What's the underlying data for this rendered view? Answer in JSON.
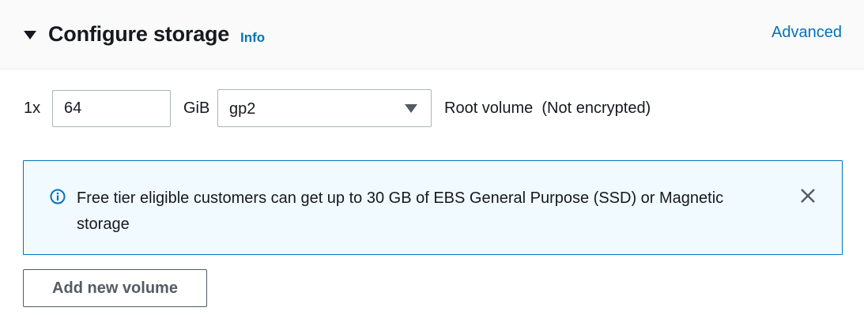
{
  "section": {
    "title": "Configure storage",
    "info_link": "Info",
    "advanced_link": "Advanced"
  },
  "volume": {
    "count_label": "1x",
    "size_value": "64",
    "unit_label": "GiB",
    "volume_type": "gp2",
    "description": "Root volume  (Not encrypted)"
  },
  "alert": {
    "icon": "info-circle-icon",
    "message": "Free tier eligible customers can get up to 30 GB of EBS General Purpose (SSD) or Magnetic storage",
    "close_icon": "close-icon"
  },
  "actions": {
    "add_volume_label": "Add new volume"
  },
  "colors": {
    "link": "#0073bb",
    "alert_background": "#f1faff",
    "alert_border": "#0073bb",
    "text": "#16191f"
  }
}
